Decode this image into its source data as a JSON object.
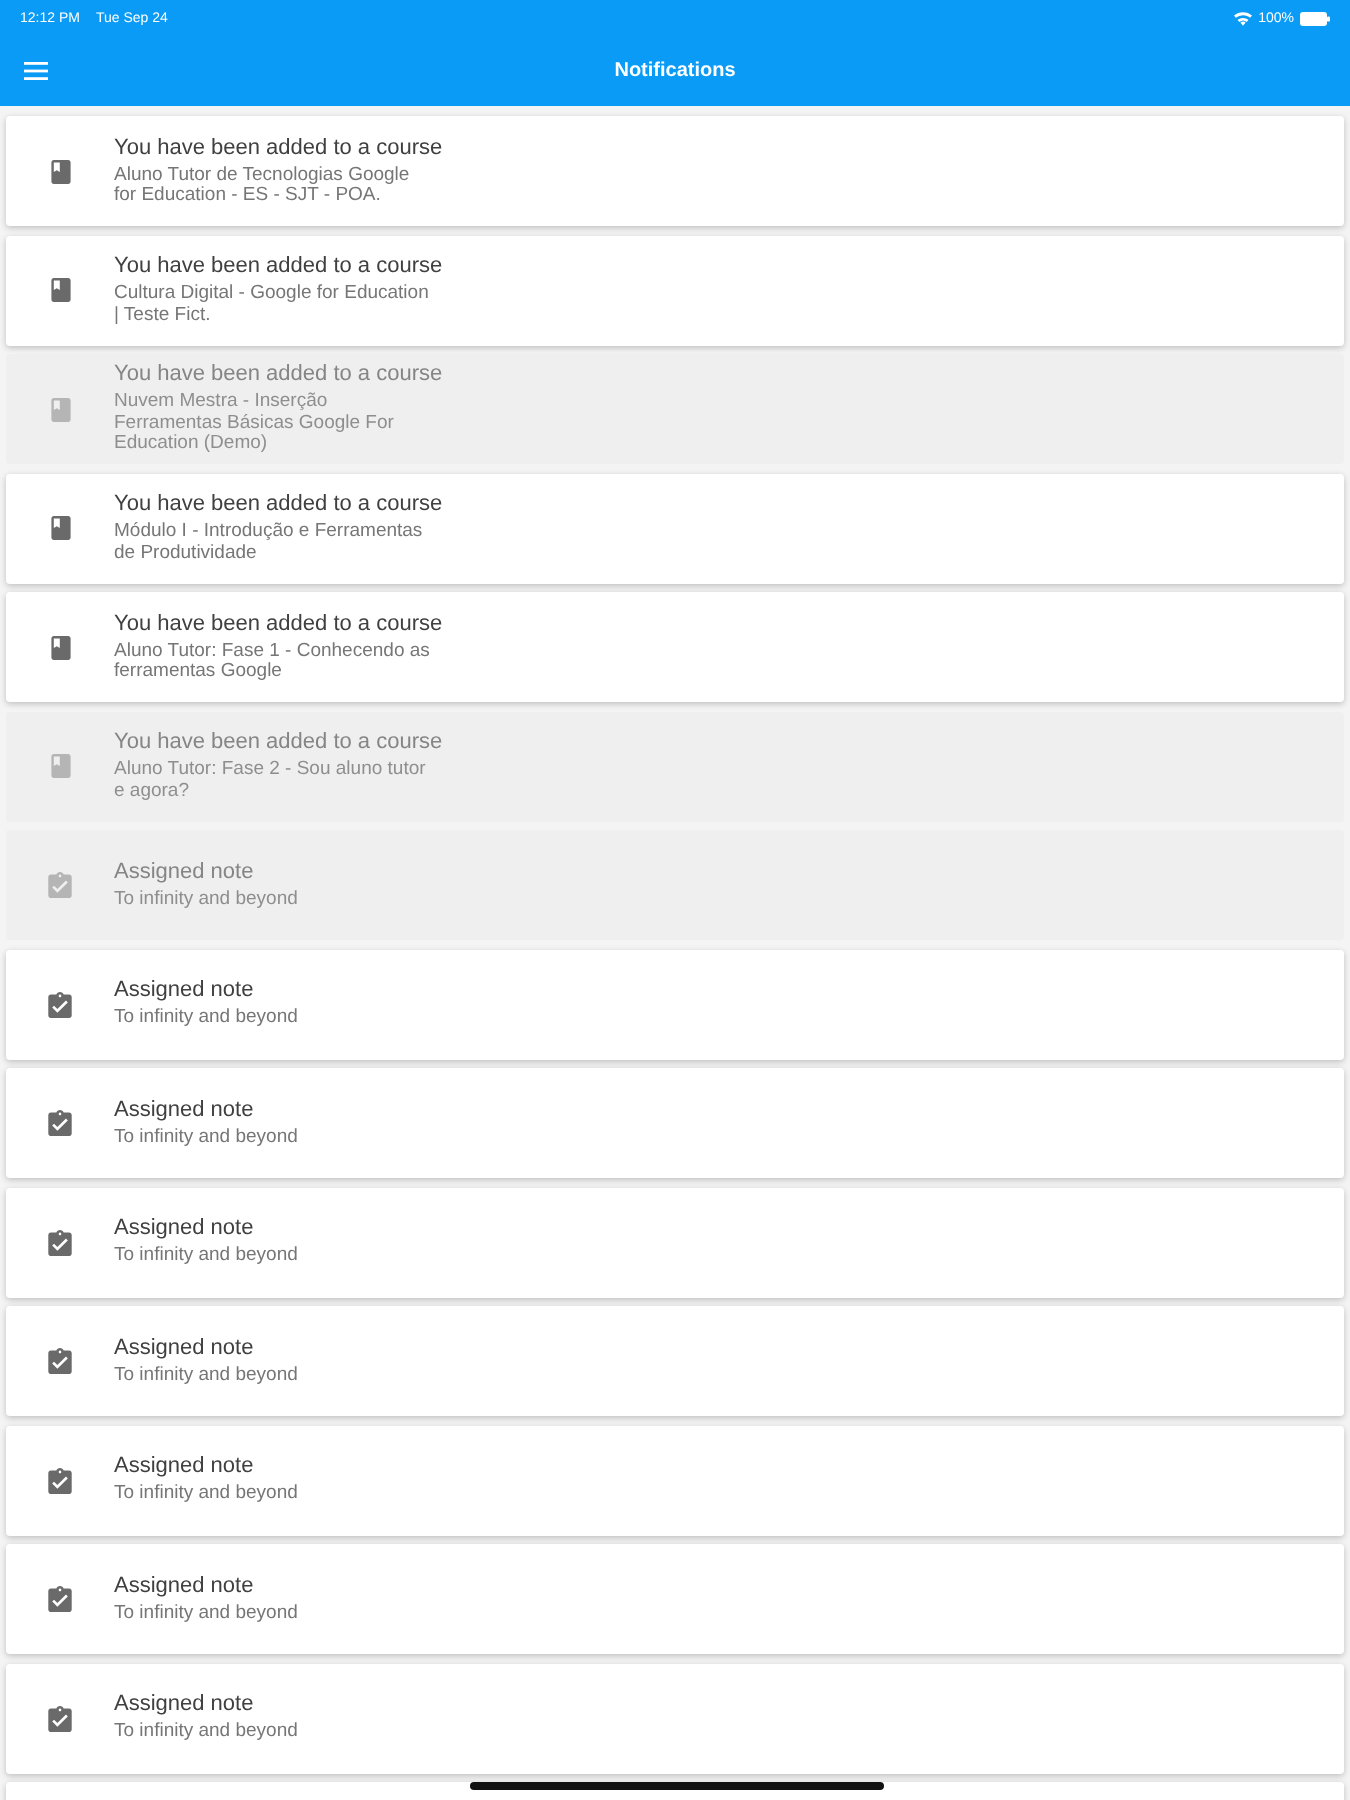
{
  "status_bar": {
    "time": "12:12 PM",
    "date": "Tue Sep 24",
    "battery": "100%"
  },
  "app_bar": {
    "title": "Notifications"
  },
  "notifications": [
    {
      "kind": "course",
      "title": "You have been added to a course",
      "subtitle": "Aluno Tutor de Tecnologias Google for Education - ES - SJT - POA.",
      "read": false
    },
    {
      "kind": "course",
      "title": "You have been added to a course",
      "subtitle": "Cultura Digital - Google for Education | Teste Fict.",
      "read": false
    },
    {
      "kind": "course",
      "title": "You have been added to a course",
      "subtitle": "Nuvem Mestra - Inserção Ferramentas Básicas Google For Education (Demo)",
      "read": true
    },
    {
      "kind": "course",
      "title": "You have been added to a course",
      "subtitle": "Módulo I - Introdução e Ferramentas de Produtividade",
      "read": false
    },
    {
      "kind": "course",
      "title": "You have been added to a course",
      "subtitle": "Aluno Tutor: Fase 1 - Conhecendo as ferramentas Google",
      "read": false
    },
    {
      "kind": "course",
      "title": "You have been added to a course",
      "subtitle": "Aluno Tutor: Fase 2 - Sou aluno tutor e agora?",
      "read": true
    },
    {
      "kind": "note",
      "title": "Assigned note",
      "subtitle": "To infinity and beyond",
      "read": true
    },
    {
      "kind": "note",
      "title": "Assigned note",
      "subtitle": "To infinity and beyond",
      "read": false
    },
    {
      "kind": "note",
      "title": "Assigned note",
      "subtitle": "To infinity and beyond",
      "read": false
    },
    {
      "kind": "note",
      "title": "Assigned note",
      "subtitle": "To infinity and beyond",
      "read": false
    },
    {
      "kind": "note",
      "title": "Assigned note",
      "subtitle": "To infinity and beyond",
      "read": false
    },
    {
      "kind": "note",
      "title": "Assigned note",
      "subtitle": "To infinity and beyond",
      "read": false
    },
    {
      "kind": "note",
      "title": "Assigned note",
      "subtitle": "To infinity and beyond",
      "read": false
    },
    {
      "kind": "note",
      "title": "Assigned note",
      "subtitle": "To infinity and beyond",
      "read": false
    }
  ]
}
